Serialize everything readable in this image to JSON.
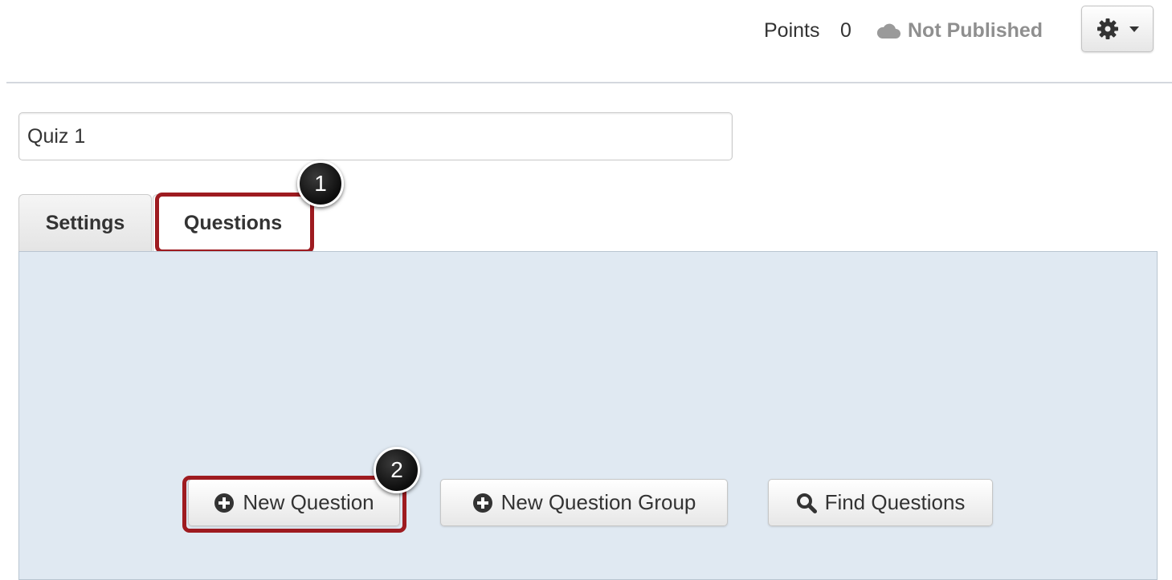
{
  "header": {
    "points_label": "Points",
    "points_value": "0",
    "status_icon": "cloud-icon",
    "status_label": "Not Published",
    "settings_icon": "gear-icon"
  },
  "quiz": {
    "title_value": "Quiz 1"
  },
  "tabs": [
    {
      "label": "Settings",
      "selected": false
    },
    {
      "label": "Questions",
      "selected": true
    }
  ],
  "callouts": [
    "1",
    "2"
  ],
  "actions": {
    "new_question": {
      "label": "New Question",
      "icon": "plus-circle-icon"
    },
    "new_question_group": {
      "label": "New Question Group",
      "icon": "plus-circle-icon"
    },
    "find_questions": {
      "label": "Find Questions",
      "icon": "search-icon"
    }
  },
  "colors": {
    "highlight": "#9e1b20",
    "panel_bg": "#e0e9f2",
    "status_text": "#8f8f8f"
  }
}
